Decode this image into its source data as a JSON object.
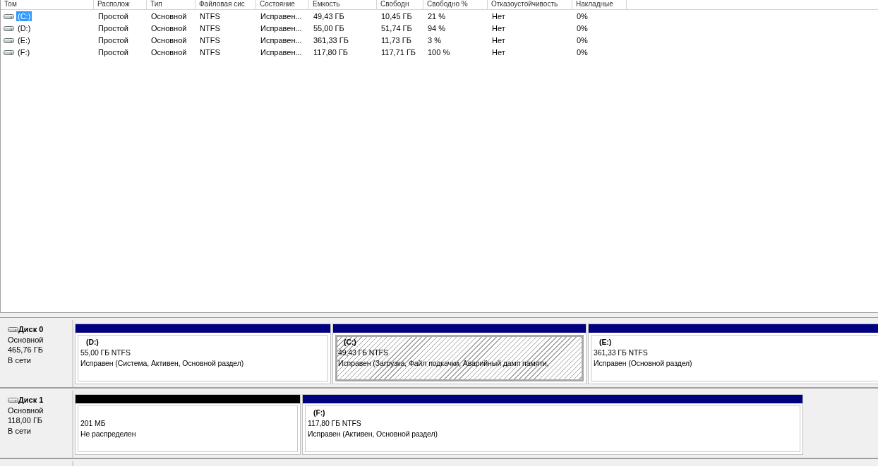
{
  "volume_table": {
    "columns": [
      "Том",
      "Располож",
      "Тип",
      "Файловая сис",
      "Состояние",
      "Емкость",
      "Свободн",
      "Свободно %",
      "Отказоустойчивость",
      "Накладные"
    ],
    "rows": [
      {
        "selected": true,
        "cells": [
          "(C:)",
          "Простой",
          "Основной",
          "NTFS",
          "Исправен...",
          "49,43 ГБ",
          "10,45 ГБ",
          "21 %",
          "Нет",
          "0%"
        ]
      },
      {
        "selected": false,
        "cells": [
          "(D:)",
          "Простой",
          "Основной",
          "NTFS",
          "Исправен...",
          "55,00 ГБ",
          "51,74 ГБ",
          "94 %",
          "Нет",
          "0%"
        ]
      },
      {
        "selected": false,
        "cells": [
          "(E:)",
          "Простой",
          "Основной",
          "NTFS",
          "Исправен...",
          "361,33 ГБ",
          "11,73 ГБ",
          "3 %",
          "Нет",
          "0%"
        ]
      },
      {
        "selected": false,
        "cells": [
          "(F:)",
          "Простой",
          "Основной",
          "NTFS",
          "Исправен...",
          "117,80 ГБ",
          "117,71 ГБ",
          "100 %",
          "Нет",
          "0%"
        ]
      }
    ]
  },
  "disks": [
    {
      "name": "Диск 0",
      "type": "Основной",
      "size": "465,76 ГБ",
      "status": "В сети",
      "partitions": [
        {
          "kind": "primary",
          "selected": false,
          "label": "(D:)",
          "size": "55,00 ГБ NTFS",
          "status": "Исправен (Система, Активен, Основной раздел)"
        },
        {
          "kind": "primary",
          "selected": true,
          "label": "(C:)",
          "size": "49,43 ГБ NTFS",
          "status": "Исправен (Загрузка, Файл подкачки, Аварийный дамп памяти,"
        },
        {
          "kind": "primary",
          "selected": false,
          "label": "(E:)",
          "size": "361,33 ГБ NTFS",
          "status": "Исправен (Основной раздел)"
        }
      ]
    },
    {
      "name": "Диск 1",
      "type": "Основной",
      "size": "118,00 ГБ",
      "status": "В сети",
      "partitions": [
        {
          "kind": "unallocated",
          "selected": false,
          "size": "201 МБ",
          "status": "Не распределен"
        },
        {
          "kind": "primary",
          "selected": false,
          "label": "(F:)",
          "size": "117,80 ГБ NTFS",
          "status": "Исправен (Активен, Основной раздел)"
        }
      ]
    }
  ]
}
